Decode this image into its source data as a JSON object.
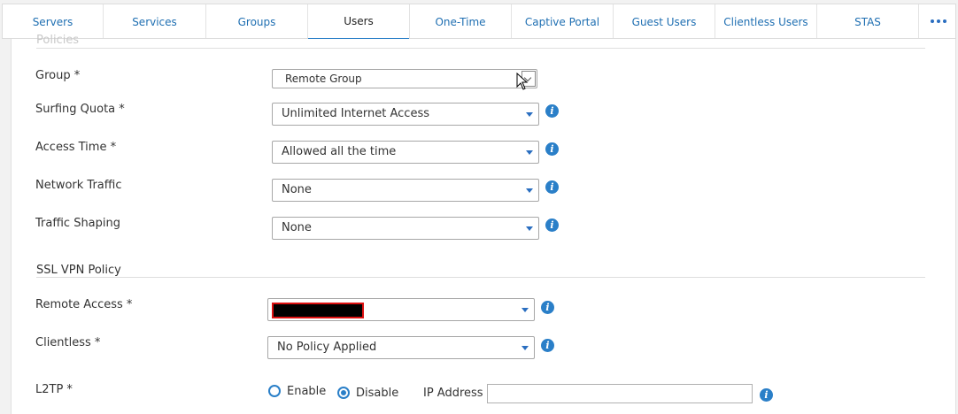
{
  "tabs": [
    {
      "label": "Servers"
    },
    {
      "label": "Services"
    },
    {
      "label": "Groups"
    },
    {
      "label": "Users",
      "active": true
    },
    {
      "label": "One-Time Password"
    },
    {
      "label": "Captive Portal"
    },
    {
      "label": "Guest Users"
    },
    {
      "label": "Clientless Users"
    },
    {
      "label": "STAS"
    }
  ],
  "more_icon": "ellipsis-icon",
  "policies": {
    "section_title": "Policies",
    "group": {
      "label": "Group *",
      "value": "Remote Group"
    },
    "surfing_quota": {
      "label": "Surfing Quota *",
      "value": "Unlimited Internet Access"
    },
    "access_time": {
      "label": "Access Time *",
      "value": "Allowed all the time"
    },
    "network_traffic": {
      "label": "Network Traffic",
      "value": "None"
    },
    "traffic_shaping": {
      "label": "Traffic Shaping",
      "value": "None"
    }
  },
  "ssl_vpn": {
    "section_title": "SSL VPN Policy",
    "remote_access": {
      "label": "Remote Access *",
      "value": ""
    },
    "clientless": {
      "label": "Clientless *",
      "value": "No Policy Applied"
    },
    "l2tp": {
      "label": "L2TP *",
      "enable_label": "Enable",
      "disable_label": "Disable",
      "selected": "Disable",
      "ip_label": "IP Address",
      "ip_value": ""
    }
  },
  "info_glyph": "i",
  "colors": {
    "accent": "#2a7fc8",
    "tab_text": "#1f6fb2",
    "redaction_border": "#dd1111"
  }
}
